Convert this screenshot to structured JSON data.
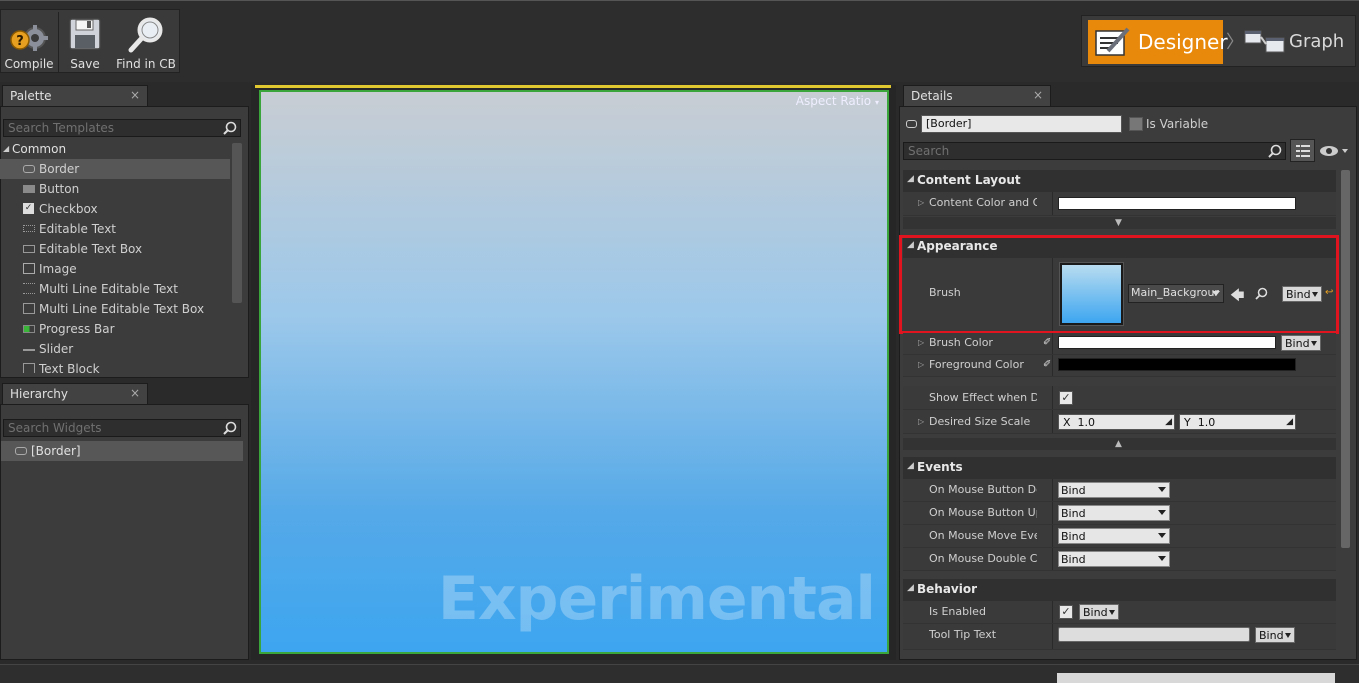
{
  "toolbar": {
    "compile_label": "Compile",
    "save_label": "Save",
    "find_label": "Find in CB"
  },
  "mode": {
    "designer_label": "Designer",
    "graph_label": "Graph",
    "chevron": "〉"
  },
  "palette": {
    "tab_label": "Palette",
    "close": "×",
    "search_placeholder": "Search Templates",
    "category": "Common",
    "items": [
      "Border",
      "Button",
      "Checkbox",
      "Editable Text",
      "Editable Text Box",
      "Image",
      "Multi Line Editable Text",
      "Multi Line Editable Text Box",
      "Progress Bar",
      "Slider",
      "Text Block"
    ]
  },
  "hierarchy": {
    "tab_label": "Hierarchy",
    "close": "×",
    "search_placeholder": "Search Widgets",
    "root": "[Border]"
  },
  "canvas": {
    "aspect_label": "Aspect Ratio",
    "watermark": "Experimental"
  },
  "details": {
    "tab_label": "Details",
    "close": "×",
    "name_value": "[Border]",
    "is_variable_label": "Is Variable",
    "search_placeholder": "Search",
    "content_layout": {
      "header": "Content Layout",
      "color_label": "Content Color and Op"
    },
    "appearance": {
      "header": "Appearance",
      "brush_label": "Brush",
      "brush_asset": "Main_Backgrour",
      "bind": "Bind",
      "brush_color_label": "Brush Color",
      "foreground_label": "Foreground Color",
      "show_effect_label": "Show Effect when Dis",
      "desired_size_label": "Desired Size Scale",
      "x_label": "X",
      "x_value": "1.0",
      "y_label": "Y",
      "y_value": "1.0"
    },
    "events": {
      "header": "Events",
      "rows": [
        "On Mouse Button Dov",
        "On Mouse Button Up",
        "On Mouse Move Ever",
        "On Mouse Double Clic"
      ],
      "bind": "Bind"
    },
    "behavior": {
      "header": "Behavior",
      "enabled_label": "Is Enabled",
      "tooltip_label": "Tool Tip Text",
      "bind": "Bind"
    }
  },
  "colors": {
    "accent": "#e8890c",
    "highlight": "#e0141e",
    "canvas_border": "#3aa53a"
  }
}
